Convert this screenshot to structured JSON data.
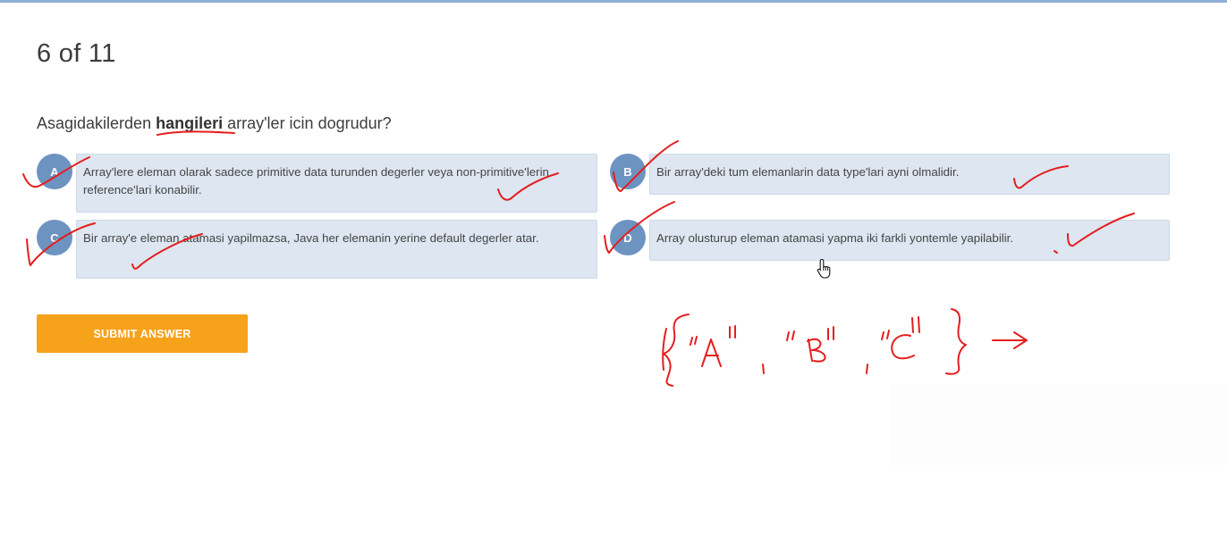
{
  "header": {
    "progress": "6 of 11"
  },
  "question": {
    "prefix": "Asagidakilerden ",
    "emphasis": "hangileri",
    "suffix": " array'ler icin dogrudur?"
  },
  "options": [
    {
      "letter": "A",
      "text": "Array'lere eleman olarak sadece primitive data turunden degerler veya non-primitive'lerin reference'lari konabilir."
    },
    {
      "letter": "B",
      "text": "Bir array'deki tum elemanlarin data type'lari ayni olmalidir."
    },
    {
      "letter": "C",
      "text": "Bir array'e eleman atamasi yapilmazsa, Java her elemanin yerine default degerler atar."
    },
    {
      "letter": "D",
      "text": "Array olusturup eleman atamasi yapma iki farkli yontemle yapilabilir."
    }
  ],
  "submit": {
    "label": "SUBMIT ANSWER"
  },
  "icons": {
    "cursor": "hand-pointer-icon"
  },
  "colors": {
    "accent": "#f7a21b",
    "badge": "#6d93c1",
    "option_bg": "#dde6f1",
    "annotation": "#e41e1e"
  }
}
